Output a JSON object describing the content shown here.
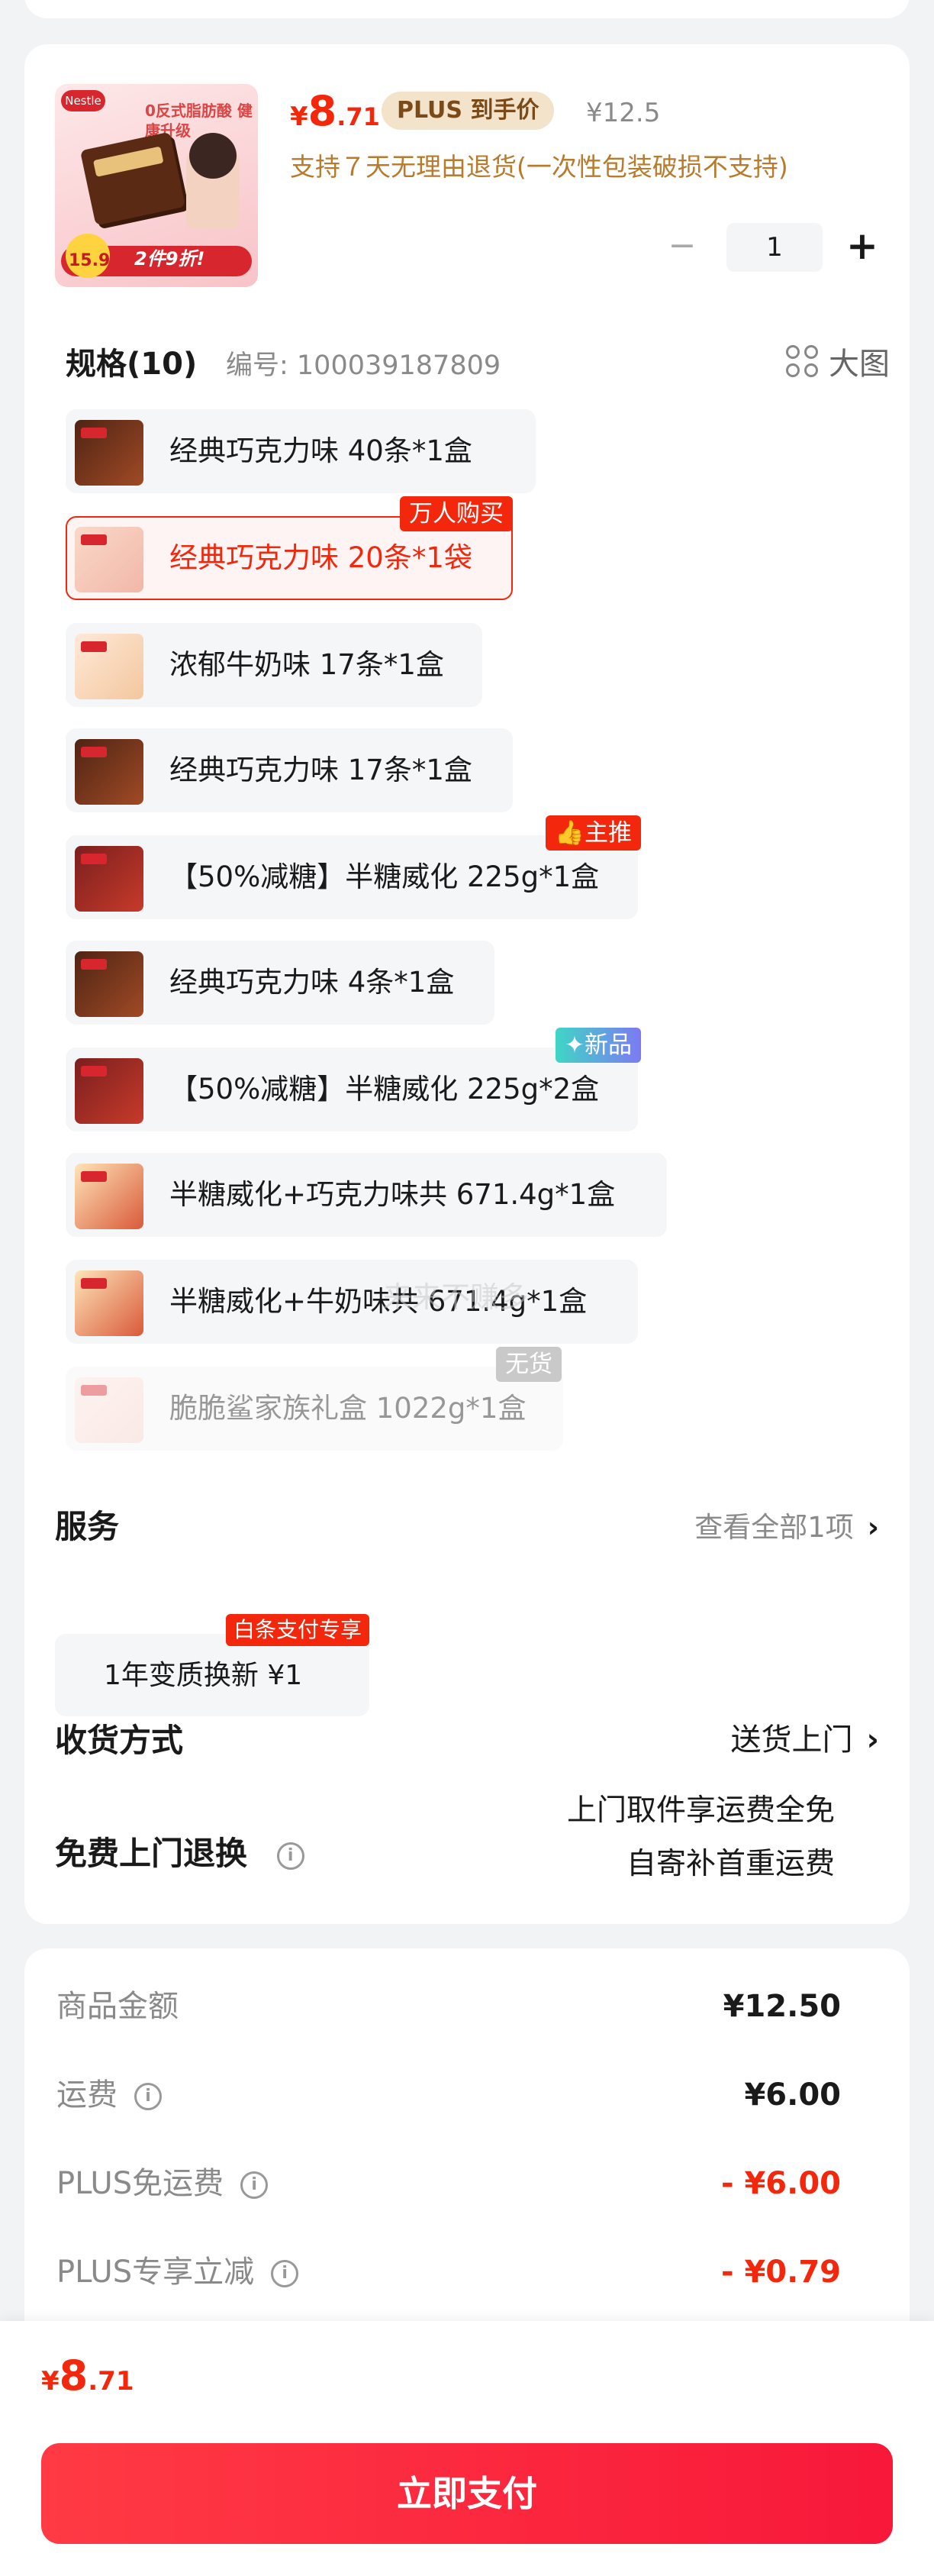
{
  "product": {
    "thumb_price": "15.9",
    "thumb_promo": "2件9折!",
    "thumb_slogan": "0反式脂肪酸 健康升级",
    "thumb_brand": "Nestle",
    "price_currency": "¥",
    "price_integer": "8",
    "price_decimal": ".71",
    "plus_tag": "PLUS 到手价",
    "original_price": "¥12.5",
    "return_note": "支持７天无理由退货(一次性包装破损不支持)",
    "quantity": "1",
    "minus": "−",
    "plus": "+"
  },
  "spec": {
    "title": "规格(10)",
    "code_label": "编号: 100039187809",
    "big_view_label": "大图"
  },
  "variants": [
    {
      "label": "经典巧克力味 40条*1盒",
      "tag": ""
    },
    {
      "label": "经典巧克力味 20条*1袋",
      "tag": "万人购买"
    },
    {
      "label": "浓郁牛奶味 17条*1盒",
      "tag": ""
    },
    {
      "label": "经典巧克力味 17条*1盒",
      "tag": ""
    },
    {
      "label": "【50%减糖】半糖威化 225g*1盒",
      "tag": "👍主推"
    },
    {
      "label": "经典巧克力味 4条*1盒",
      "tag": ""
    },
    {
      "label": "【50%减糖】半糖威化 225g*2盒",
      "tag": "✦新品"
    },
    {
      "label": "半糖威化+巧克力味共 671.4g*1盒",
      "tag": ""
    },
    {
      "label": "半糖威化+牛奶味共 671.4g*1盒",
      "tag": ""
    },
    {
      "label": "脆脆鲨家族礼盒 1022g*1盒",
      "tag": "无货"
    }
  ],
  "watermark": "来来不赚多",
  "service": {
    "title": "服务",
    "view_all": "查看全部1项",
    "chip_label": "1年变质换新 ¥1",
    "chip_tag": "白条支付专享"
  },
  "delivery": {
    "title": "收货方式",
    "value": "送货上门"
  },
  "free_return": {
    "title": "免费上门退换",
    "line1": "上门取件享运费全免",
    "line2": "自寄补首重运费"
  },
  "summary": {
    "rows": [
      {
        "key": "商品金额",
        "value": "¥12.50"
      },
      {
        "key": "运费",
        "value": "¥6.00"
      },
      {
        "key": "PLUS免运费",
        "value": "- ¥6.00"
      },
      {
        "key": "PLUS专享立减",
        "value": "- ¥0.79"
      }
    ]
  },
  "footer": {
    "currency": "¥",
    "integer": "8",
    "decimal": ".71",
    "pay_label": "立即支付"
  },
  "colors": {
    "accent": "#f2270c",
    "plus_tag_bg": "#f3e3cb",
    "return_note": "#b87a2c"
  }
}
